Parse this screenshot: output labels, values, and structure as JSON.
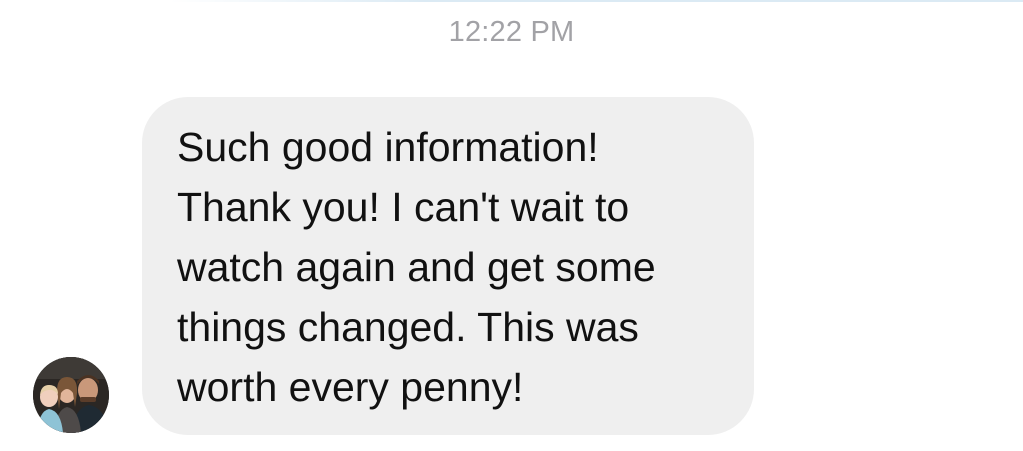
{
  "header": {
    "timestamp": "12:22 PM"
  },
  "message": {
    "sender_avatar_icon": "user-photo-avatar",
    "text": "Such good information!\nThank you! I can't wait to\nwatch again and get some\nthings changed. This was\nworth every penny!",
    "direction": "incoming"
  },
  "colors": {
    "bubble_background": "#efefef",
    "timestamp_text": "#a2a2a6",
    "message_text": "#111111"
  }
}
